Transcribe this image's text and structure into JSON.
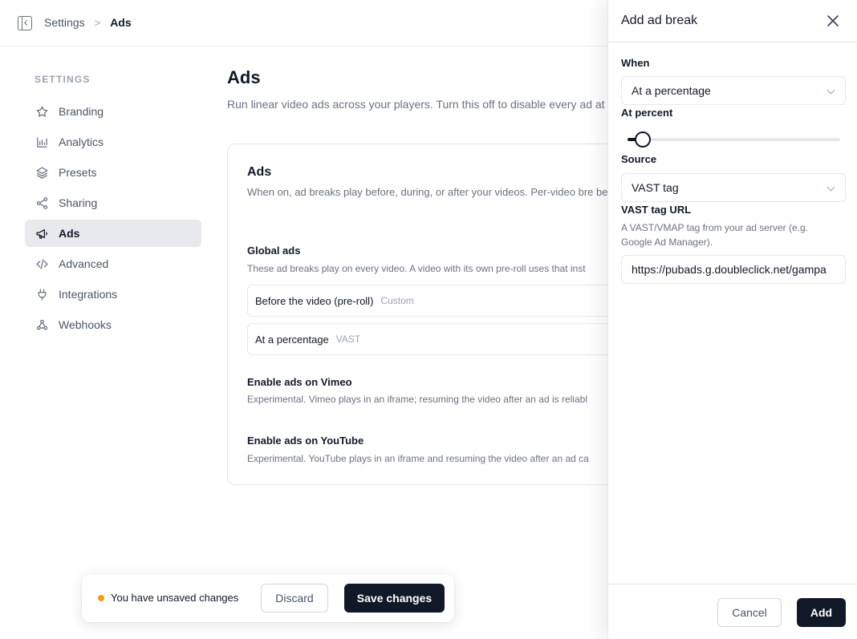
{
  "breadcrumb": {
    "parent": "Settings",
    "separator": ">",
    "current": "Ads"
  },
  "sidebar": {
    "title": "SETTINGS",
    "items": [
      {
        "label": "Branding",
        "icon": "star-icon"
      },
      {
        "label": "Analytics",
        "icon": "bar-chart-icon"
      },
      {
        "label": "Presets",
        "icon": "layers-icon"
      },
      {
        "label": "Sharing",
        "icon": "share-icon"
      },
      {
        "label": "Ads",
        "icon": "megaphone-icon",
        "active": true
      },
      {
        "label": "Advanced",
        "icon": "code-icon"
      },
      {
        "label": "Integrations",
        "icon": "plug-icon"
      },
      {
        "label": "Webhooks",
        "icon": "webhook-icon"
      }
    ]
  },
  "main": {
    "title": "Ads",
    "subtitle": "Run linear video ads across your players. Turn this off to disable every ad at on",
    "card": {
      "title": "Ads",
      "description": "When on, ad breaks play before, during, or after your videos. Per-video bre below.",
      "global_ads": {
        "title": "Global ads",
        "description": "These ad breaks play on every video. A video with its own pre-roll uses that inst",
        "breaks": [
          {
            "label": "Before the video (pre-roll)",
            "tag": "Custom"
          },
          {
            "label": "At a percentage",
            "tag": "VAST"
          }
        ]
      },
      "vimeo": {
        "title": "Enable ads on Vimeo",
        "description": "Experimental. Vimeo plays in an iframe; resuming the video after an ad is reliabl"
      },
      "youtube": {
        "title": "Enable ads on YouTube",
        "description": "Experimental. YouTube plays in an iframe and resuming the video after an ad ca"
      }
    }
  },
  "unsaved_bar": {
    "message": "You have unsaved changes",
    "discard_label": "Discard",
    "save_label": "Save changes",
    "dot_color": "#f59e0b"
  },
  "drawer": {
    "title": "Add ad break",
    "when": {
      "label": "When",
      "value": "At a percentage"
    },
    "at_percent": {
      "label": "At percent",
      "value": 7
    },
    "source": {
      "label": "Source",
      "value": "VAST tag"
    },
    "vast_url": {
      "label": "VAST tag URL",
      "help": "A VAST/VMAP tag from your ad server (e.g. Google Ad Manager).",
      "value": "https://pubads.g.doubleclick.net/gampa"
    },
    "cancel_label": "Cancel",
    "add_label": "Add"
  }
}
